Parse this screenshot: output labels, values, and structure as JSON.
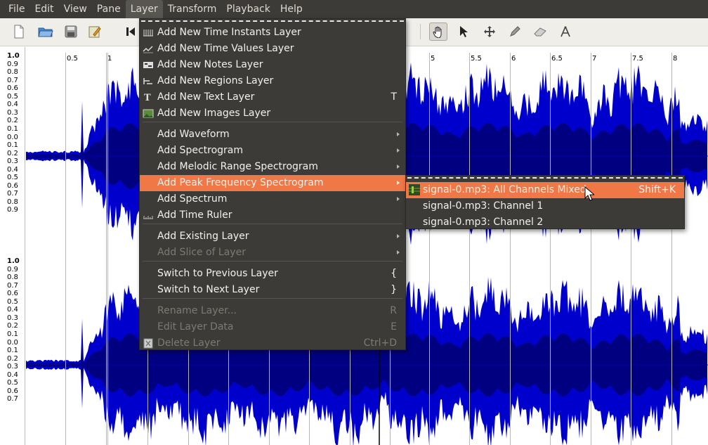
{
  "menubar": {
    "items": [
      "File",
      "Edit",
      "View",
      "Pane",
      "Layer",
      "Transform",
      "Playback",
      "Help"
    ],
    "active": "Layer"
  },
  "ruler": {
    "labels": [
      "0.5",
      "1",
      "5",
      "5.5",
      "6",
      "6.5",
      "7",
      "7.5",
      "8"
    ]
  },
  "vscale": {
    "top_labels": [
      "1.0",
      "0.9",
      "0.8",
      "0.7",
      "0.6",
      "0.5",
      "0.4",
      "0.3",
      "0.2",
      "0.1",
      "0.0",
      "0.1",
      "0.2",
      "0.3",
      "0.4",
      "0.5",
      "0.6",
      "0.7",
      "0.8",
      "0.9"
    ],
    "bottom_labels": [
      "1.0",
      "0.9",
      "0.8",
      "0.7",
      "0.6",
      "0.5",
      "0.4",
      "0.3",
      "0.2",
      "0.1",
      "0.0",
      "0.1",
      "0.2",
      "0.3",
      "0.4",
      "0.5",
      "0.6",
      "0.7"
    ]
  },
  "layer_menu": {
    "items": [
      {
        "label": "Add New Time Instants Layer",
        "icon": "time-instants-icon",
        "shortcut": ""
      },
      {
        "label": "Add New Time Values Layer",
        "icon": "time-values-icon",
        "shortcut": ""
      },
      {
        "label": "Add New Notes Layer",
        "icon": "notes-icon",
        "shortcut": ""
      },
      {
        "label": "Add New Regions Layer",
        "icon": "regions-icon",
        "shortcut": ""
      },
      {
        "label": "Add New Text Layer",
        "icon": "text-icon",
        "shortcut": "T"
      },
      {
        "label": "Add New Images Layer",
        "icon": "images-icon",
        "shortcut": ""
      },
      {
        "label": "Add Waveform",
        "submenu": true
      },
      {
        "label": "Add Spectrogram",
        "submenu": true
      },
      {
        "label": "Add Melodic Range Spectrogram",
        "submenu": true
      },
      {
        "label": "Add Peak Frequency Spectrogram",
        "submenu": true,
        "highlighted": true
      },
      {
        "label": "Add Spectrum",
        "submenu": true
      },
      {
        "label": "Add Time Ruler",
        "icon": "ruler-icon"
      },
      {
        "label": "Add Existing Layer",
        "submenu": true
      },
      {
        "label": "Add Slice of Layer",
        "submenu": true,
        "disabled": true
      },
      {
        "label": "Switch to Previous Layer",
        "shortcut": "{"
      },
      {
        "label": "Switch to Next Layer",
        "shortcut": "}"
      },
      {
        "label": "Rename Layer...",
        "shortcut": "R",
        "disabled": true
      },
      {
        "label": "Edit Layer Data",
        "shortcut": "E",
        "disabled": true
      },
      {
        "label": "Delete Layer",
        "shortcut": "Ctrl+D",
        "disabled": true,
        "icon": "delete-icon"
      }
    ]
  },
  "submenu": {
    "items": [
      {
        "label": "signal-0.mp3: All Channels Mixed",
        "shortcut": "Shift+K",
        "highlighted": true
      },
      {
        "label": "signal-0.mp3: Channel 1",
        "shortcut": ""
      },
      {
        "label": "signal-0.mp3: Channel 2",
        "shortcut": ""
      }
    ]
  },
  "colors": {
    "menu_bg": "#3c3b37",
    "highlight": "#f07746",
    "wave": "#0000cc",
    "wave_dark": "#000080"
  }
}
